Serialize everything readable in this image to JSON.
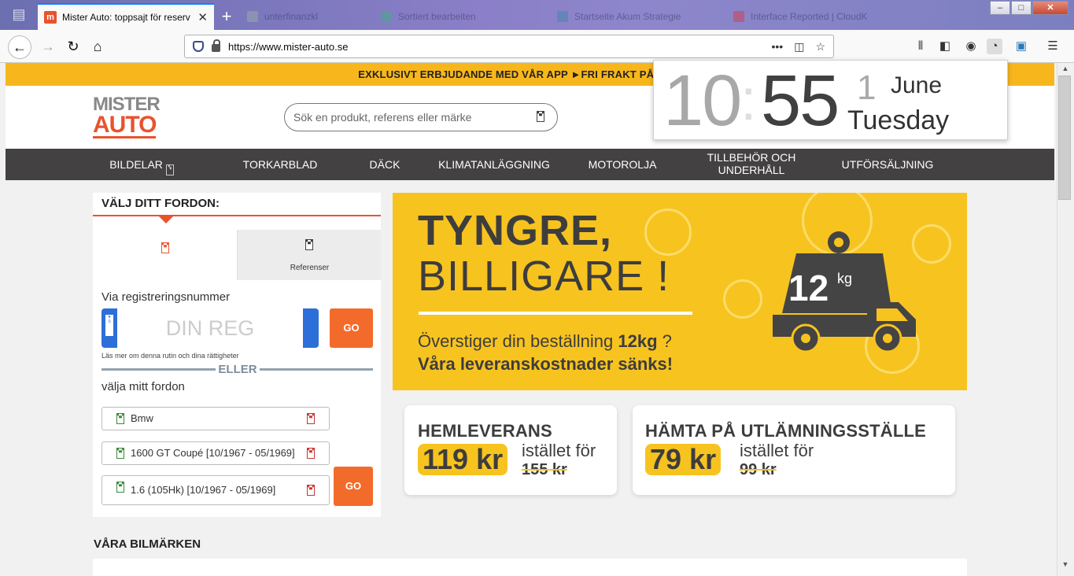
{
  "browser": {
    "active_tab_title": "Mister Auto: toppsajt för reserv",
    "bg_tabs": [
      "unterfinanzkl",
      "Sortiert bearbeiten",
      "Startseite Akum Strategie",
      "Interface Reported | CloudK"
    ],
    "url_host": "https://www.mister-auto.se",
    "window_controls": {
      "minimize": "‒",
      "maximize": "□",
      "close": "✕"
    }
  },
  "clock": {
    "hour": "10",
    "minute": "55",
    "day": "1",
    "month": "June",
    "weekday": "Tuesday"
  },
  "promo": {
    "text": "EXKLUSIVT ERBJUDANDE MED VÅR APP ►FRI FRAKT PÅ ALLA OF"
  },
  "header": {
    "logo_top": "MISTER",
    "logo_bottom": "AUTO",
    "search_placeholder": "Sök en produkt, referens eller märke"
  },
  "nav": [
    "BILDELAR",
    "TORKARBLAD",
    "DÄCK",
    "KLIMATANLÄGGNING",
    "MOTOROLJA",
    "TILLBEHÖR OCH UNDERHÅLL",
    "UTFÖRSÄLJNING"
  ],
  "vehicle": {
    "title": "VÄLJ DITT FORDON:",
    "tab2_label": "Referenser",
    "reg_label": "Via registreringsnummer",
    "plate_placeholder": "DIN REG",
    "go": "GO",
    "privacy": "Läs mer om denna rutin och dina rättigheter",
    "or": "ELLER",
    "choose_label": "välja mitt fordon",
    "selects": [
      "Bmw",
      "1600 GT Coupé [10/1967 - 05/1969]",
      "1.6 (105Hk) [10/1967 - 05/1969]"
    ],
    "go2": "GO"
  },
  "banner": {
    "title1": "TYNGRE,",
    "title2": "BILLIGARE !",
    "line1_pre": "Överstiger din beställning ",
    "line1_bold": "12kg",
    "line1_post": " ?",
    "line2": "Våra leveranskostnader sänks!",
    "weight": "12",
    "weight_unit": "kg"
  },
  "cards": [
    {
      "title": "HEMLEVERANS",
      "price": "119 kr",
      "instead": "istället för",
      "old": "155 kr"
    },
    {
      "title": "HÄMTA PÅ UTLÄMNINGSSTÄLLE",
      "price": "79 kr",
      "instead": "istället för",
      "old": "99 kr"
    }
  ],
  "brands_title": "VÅRA BILMÄRKEN",
  "colors": {
    "brand": "#e8532e",
    "accent": "#f7c31f",
    "go": "#f36b2a",
    "nav": "#444142"
  }
}
